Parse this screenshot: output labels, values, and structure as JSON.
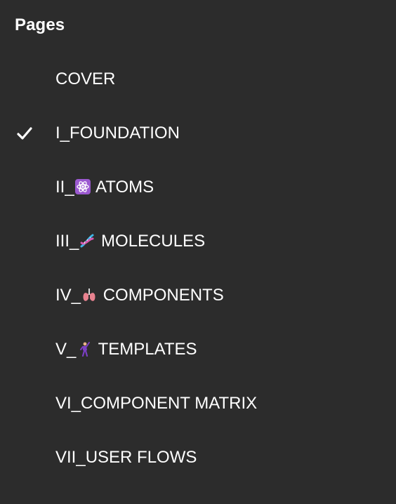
{
  "panel": {
    "title": "Pages"
  },
  "pages": [
    {
      "prefix": "COVER",
      "emoji": "",
      "suffix": "",
      "selected": false
    },
    {
      "prefix": "I_FOUNDATION",
      "emoji": "",
      "suffix": "",
      "selected": true
    },
    {
      "prefix": "II_",
      "emoji": "atom-emoji",
      "suffix": " ATOMS",
      "selected": false
    },
    {
      "prefix": "III_",
      "emoji": "dna-emoji",
      "suffix": " MOLECULES",
      "selected": false
    },
    {
      "prefix": "IV_",
      "emoji": "lungs-emoji",
      "suffix": " COMPONENTS",
      "selected": false
    },
    {
      "prefix": "V_",
      "emoji": "dancer-emoji",
      "suffix": " TEMPLATES",
      "selected": false
    },
    {
      "prefix": "VI_COMPONENT MATRIX",
      "emoji": "",
      "suffix": "",
      "selected": false
    },
    {
      "prefix": "VII_USER FLOWS",
      "emoji": "",
      "suffix": "",
      "selected": false
    }
  ],
  "colors": {
    "background": "#2c2c2c",
    "text": "#ffffff"
  },
  "icons": {
    "selected_marker": "checkmark-icon"
  }
}
